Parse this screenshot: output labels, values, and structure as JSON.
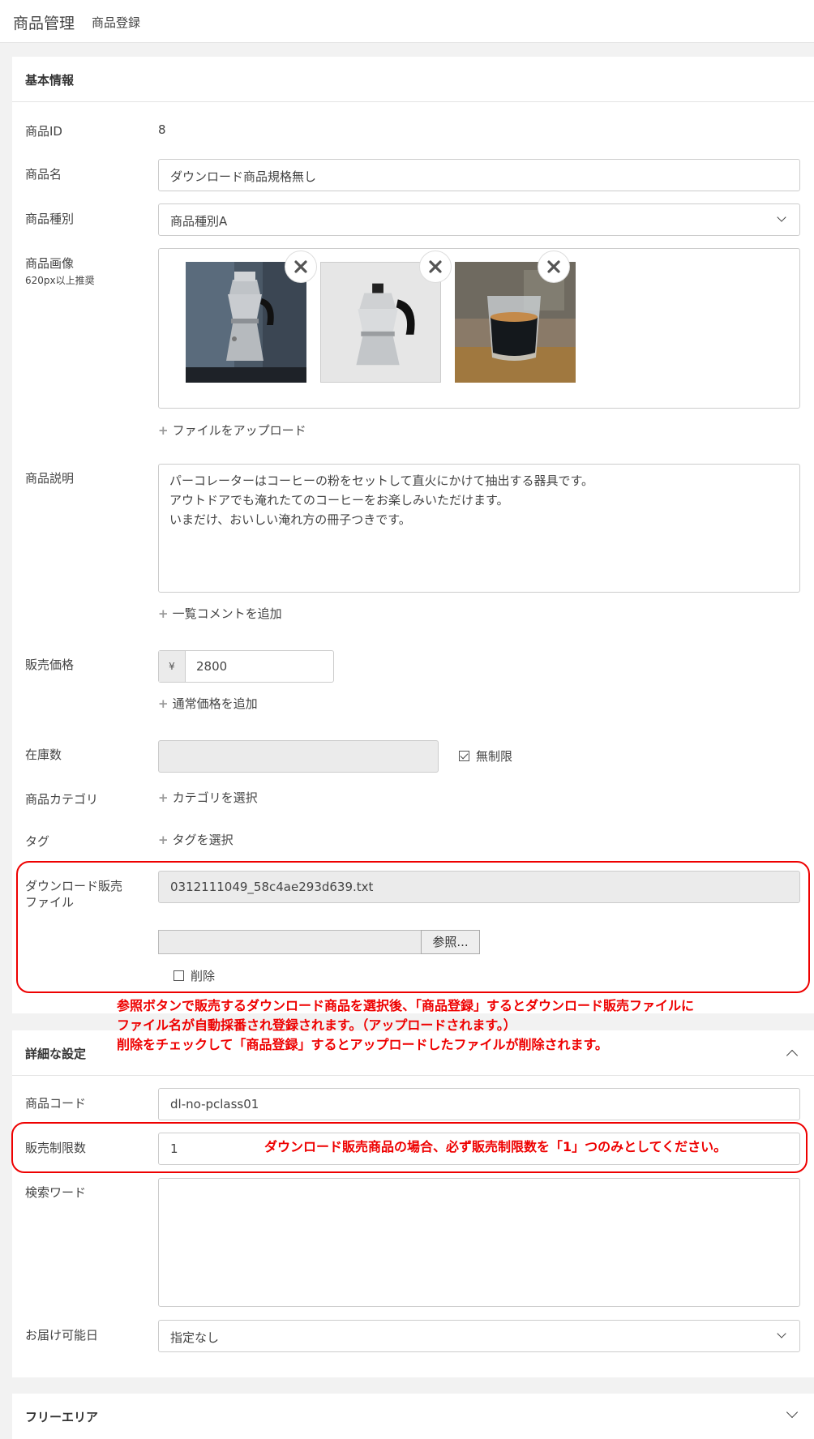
{
  "header": {
    "title": "商品管理",
    "subtitle": "商品登録"
  },
  "basic": {
    "title": "基本情報",
    "product_id": {
      "label": "商品ID",
      "value": "8"
    },
    "product_name": {
      "label": "商品名",
      "value": "ダウンロード商品規格無し"
    },
    "product_type": {
      "label": "商品種別",
      "value": "商品種別A"
    },
    "product_image": {
      "label": "商品画像",
      "note": "620px以上推奨",
      "images": [
        "coffee-maker-dark-photo",
        "coffee-maker-white-photo",
        "espresso-glass-photo"
      ],
      "upload_link": "ファイルをアップロード"
    },
    "description": {
      "label": "商品説明",
      "lines": [
        "パーコレーターはコーヒーの粉をセットして直火にかけて抽出する器具です。",
        "アウトドアでも淹れたてのコーヒーをお楽しみいただけます。",
        "いまだけ、おいしい淹れ方の冊子つきです。"
      ],
      "add_link": "一覧コメントを追加"
    },
    "price": {
      "label": "販売価格",
      "currency": "¥",
      "value": "2800",
      "add_link": "通常価格を追加"
    },
    "stock": {
      "label": "在庫数",
      "unlimited_label": "無制限",
      "unlimited_checked": true
    },
    "category": {
      "label": "商品カテゴリ",
      "link": "カテゴリを選択"
    },
    "tag": {
      "label": "タグ",
      "link": "タグを選択"
    },
    "download_file": {
      "label_line1": "ダウンロード販売",
      "label_line2": "ファイル",
      "filename": "0312111049_58c4ae293d639.txt",
      "browse_label": "参照...",
      "delete_label": "削除",
      "delete_checked": false
    }
  },
  "annotation_1": {
    "lines": [
      "参照ボタンで販売するダウンロード商品を選択後、「商品登録」するとダウンロード販売ファイルに",
      "ファイル名が自動採番され登録されます。（アップロードされます。）",
      "削除をチェックして「商品登録」するとアップロードしたファイルが削除されます。"
    ]
  },
  "detail": {
    "title": "詳細な設定",
    "product_code": {
      "label": "商品コード",
      "value": "dl-no-pclass01"
    },
    "sale_limit": {
      "label": "販売制限数",
      "value": "1"
    },
    "search_word": {
      "label": "検索ワード",
      "value": ""
    },
    "delivery_date": {
      "label": "お届け可能日",
      "value": "指定なし"
    }
  },
  "annotation_2": {
    "text": "ダウンロード販売商品の場合、必ず販売制限数を「1」つのみとしてください。"
  },
  "free_area": {
    "title": "フリーエリア"
  },
  "colors": {
    "annotation_red": "#e00000",
    "border": "#cccccc",
    "page_bg": "#f2f2f2"
  }
}
